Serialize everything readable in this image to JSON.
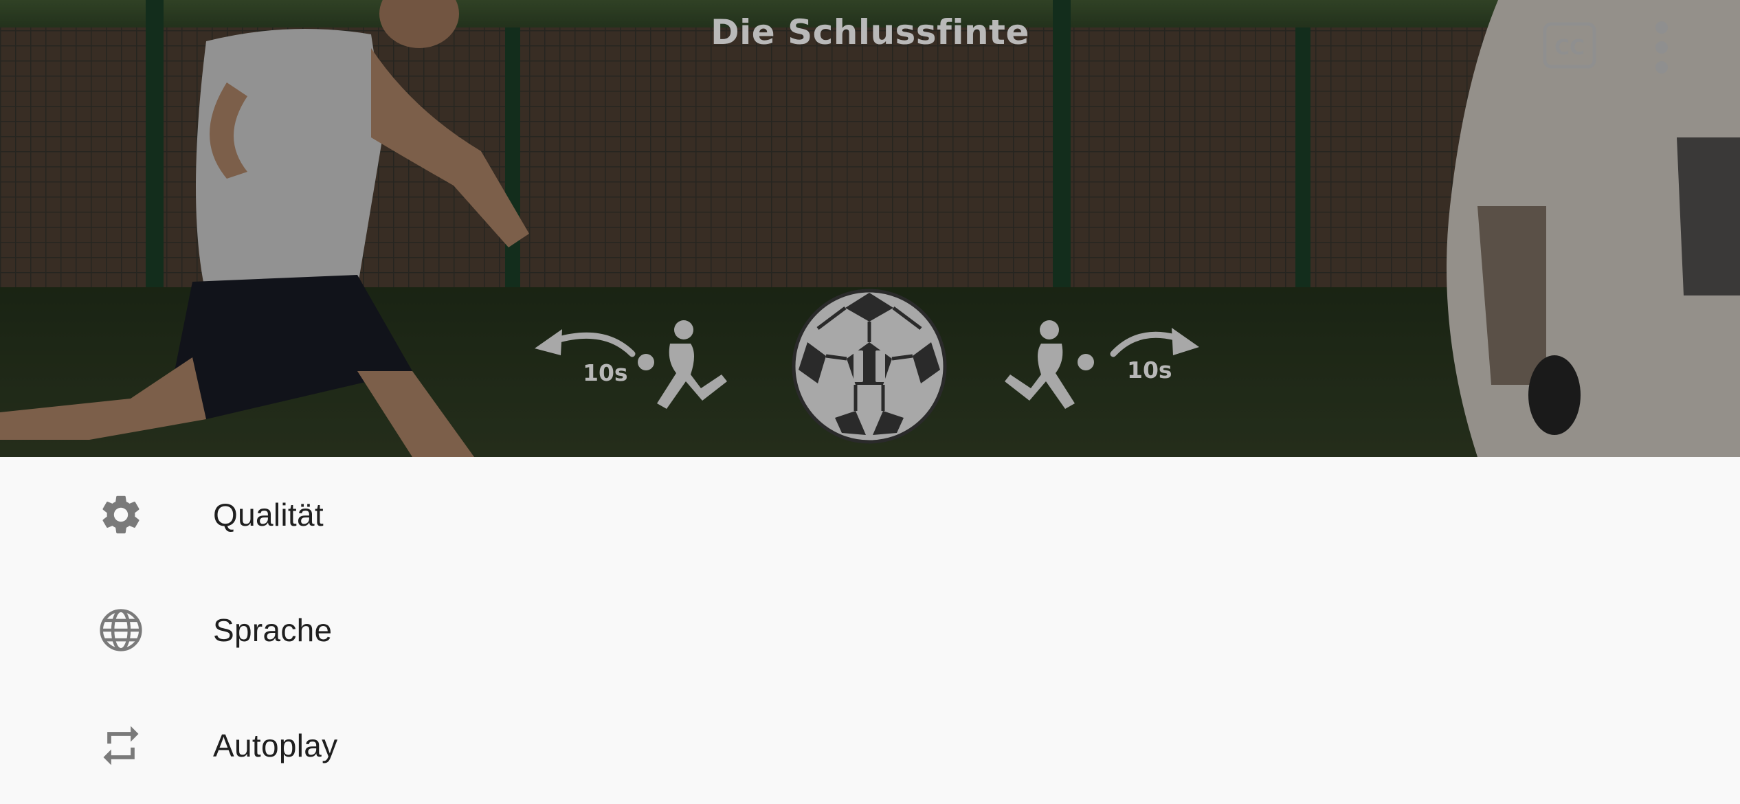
{
  "player": {
    "title": "Die Schlussfinte",
    "rewind_label": "10s",
    "forward_label": "10s",
    "state": "playing",
    "icons": {
      "captions": "closed-captions-icon",
      "more": "more-vertical-icon",
      "rewind": "rewind-10s-icon",
      "forward": "forward-10s-icon",
      "pause": "soccer-ball-pause-icon"
    }
  },
  "menu": {
    "items": [
      {
        "label": "Qualität",
        "icon": "gear-icon"
      },
      {
        "label": "Sprache",
        "icon": "globe-icon"
      },
      {
        "label": "Autoplay",
        "icon": "repeat-icon"
      }
    ]
  },
  "colors": {
    "menu_background": "#f9f9f9",
    "menu_text": "#1f1f1f",
    "icon_gray": "#7a7a7a",
    "overlay_control": "#a8a8a8"
  }
}
